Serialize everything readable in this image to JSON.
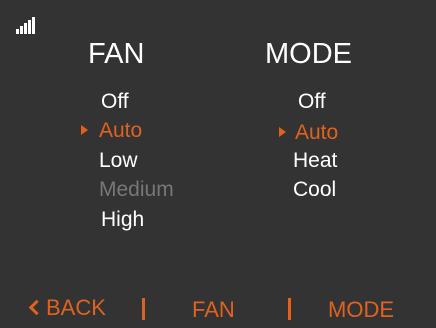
{
  "fan": {
    "title": "FAN",
    "options": [
      "Off",
      "Auto",
      "Low",
      "Medium",
      "High"
    ],
    "selected": "Auto",
    "disabled": [
      "Medium"
    ]
  },
  "mode": {
    "title": "MODE",
    "options": [
      "Off",
      "Auto",
      "Heat",
      "Cool"
    ],
    "selected": "Auto"
  },
  "footer": {
    "back_label": "BACK",
    "fan_label": "FAN",
    "mode_label": "MODE"
  },
  "colors": {
    "background": "#333333",
    "accent": "#e0621f",
    "text": "#ffffff",
    "disabled": "#777777"
  },
  "icons": {
    "signal": "signal-strength-icon",
    "selected": "caret-right-icon",
    "back": "chevron-left-icon"
  }
}
